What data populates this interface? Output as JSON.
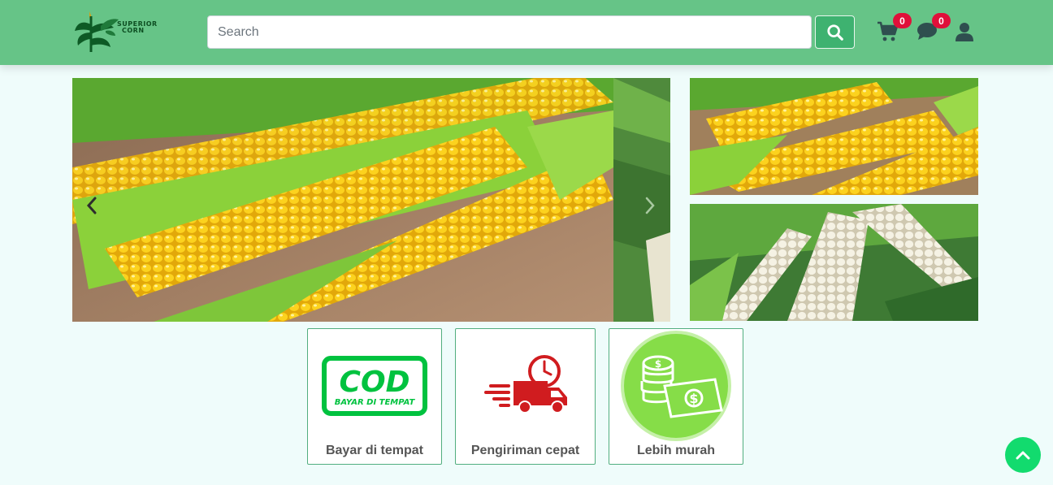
{
  "brand": {
    "logo_line1": "SUPERIOR",
    "logo_line2": "CORN"
  },
  "search": {
    "placeholder": "Search",
    "value": "",
    "button_icon": "search-icon"
  },
  "nav": {
    "cart_count": "0",
    "chat_count": "0",
    "cart_icon": "cart-icon",
    "chat_icon": "chat-icon",
    "user_icon": "user-icon"
  },
  "carousel": {
    "prev_icon": "chevron-left-icon",
    "next_icon": "chevron-right-icon"
  },
  "features": [
    {
      "label": "Bayar di tempat",
      "icon": "cod-icon",
      "badge_text": "COD",
      "badge_subtext": "BAYAR DI TEMPAT"
    },
    {
      "label": "Pengiriman cepat",
      "icon": "fast-delivery-icon"
    },
    {
      "label": "Lebih murah",
      "icon": "money-icon"
    }
  ],
  "colors": {
    "navbar": "#66c487",
    "search_button": "#3eb270",
    "badge": "#e0103a",
    "cod_green": "#00c23f",
    "delivery_red": "#d01c1f",
    "scroll_top": "#12db6e"
  }
}
